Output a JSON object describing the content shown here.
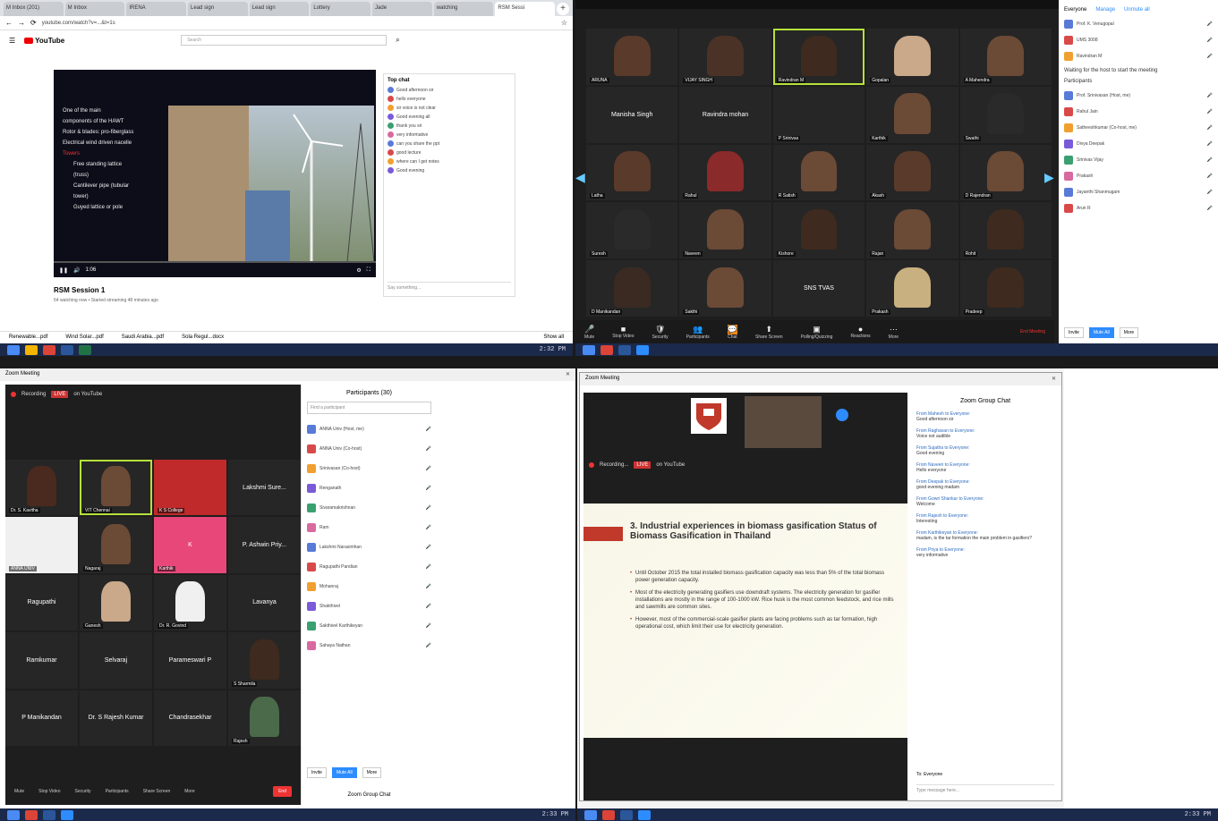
{
  "q1": {
    "tabs": [
      "M Inbox (201)",
      "M Inbox",
      "IRENA",
      "Lead sign",
      "Lead sign",
      "Lottery",
      "Jade",
      "watching",
      "RSM Sessi"
    ],
    "url": "youtube.com/watch?v=...&t=1s",
    "search_placeholder": "Search",
    "slide_title": "",
    "bullets": [
      "One of the main",
      "components of the HAWT",
      "Rotor & blades: pro-fiberglass",
      "Electrical wind driven nacelle",
      "Towers",
      "Free standing lattice",
      "(truss)",
      "Cantilever pipe (tubular",
      "tower)",
      "Guyed lattice or pole"
    ],
    "time": "1:06",
    "video_title": "RSM Session 1",
    "video_meta": "64 watching now • Started streaming 48 minutes ago",
    "chat_head": "Top chat",
    "chat": [
      "Good afternoon sir",
      "hello everyone",
      "sir voice is not clear",
      "Good evening all",
      "thank you sir",
      "very informative",
      "can you share the ppt",
      "good lecture",
      "where can I get notes",
      "Good evening"
    ],
    "chat_input": "Say something...",
    "downloads": [
      "Renewable...pdf",
      "Wind Solar...pdf",
      "Saudi Arabia...pdf",
      "Sola Regul...docx"
    ],
    "show_all": "Show all",
    "clock": "2:32 PM"
  },
  "q2": {
    "tiles": [
      {
        "name": "ARUNA",
        "face": "#5a3a2a"
      },
      {
        "name": "VIJAY SINGH",
        "face": "#4b3226"
      },
      {
        "name": "Ravindran M",
        "face": "#3e2a1e",
        "speaking": true
      },
      {
        "name": "Gopalan",
        "face": "#c9a98a"
      },
      {
        "name": "A Mahendra",
        "face": "#6b4a36"
      },
      {
        "name": "",
        "text": "Manisha Singh"
      },
      {
        "name": "",
        "text": "Ravindra mohan"
      },
      {
        "name": "P Srinivas",
        "face": ""
      },
      {
        "name": "Karthik",
        "face": "#6b4a36"
      },
      {
        "name": "Swathi",
        "face": "#2a2a2a"
      },
      {
        "name": "Latha",
        "face": "#5a3a2a"
      },
      {
        "name": "Rahul",
        "face": "#8a2a2a"
      },
      {
        "name": "R Satish",
        "face": "#6b4a36"
      },
      {
        "name": "Akash",
        "face": "#5a3a2a"
      },
      {
        "name": "D Rajendran",
        "face": "#6b4a36"
      },
      {
        "name": "Suresh",
        "face": "#2a2a2a"
      },
      {
        "name": "Naveen",
        "face": "#6b4a36"
      },
      {
        "name": "Kishore",
        "face": "#3e2a1e"
      },
      {
        "name": "Rajan",
        "face": "#6b4a36"
      },
      {
        "name": "Rohit",
        "face": "#3e2a1e"
      },
      {
        "name": "D Manikandan",
        "face": "#3a2a22"
      },
      {
        "name": "Sakthi",
        "face": "#6b4a36"
      },
      {
        "name": "",
        "text": "SNS TVAS"
      },
      {
        "name": "Prakash",
        "face": "#c9b080"
      },
      {
        "name": "Pradeep",
        "face": "#3e2a1e"
      }
    ],
    "bar": [
      {
        "g": "🎤",
        "l": "Mute"
      },
      {
        "g": "■",
        "l": "Stop Video"
      },
      {
        "g": "🛡",
        "l": "Security"
      },
      {
        "g": "👥",
        "l": "Participants"
      },
      {
        "g": "💬",
        "l": "Chat",
        "orange": true
      },
      {
        "g": "⬆",
        "l": "Share Screen"
      },
      {
        "g": "▣",
        "l": "Polling/Quizzing"
      },
      {
        "g": "●",
        "l": "Reactions"
      },
      {
        "g": "⋯",
        "l": "More"
      }
    ],
    "end": "End Meeting",
    "panel_tabs": [
      "Everyone",
      "Manage",
      "Unmute all"
    ],
    "panel_top": [
      "Prof. K. Venugopal",
      "UMS 3008",
      "Ravindran M"
    ],
    "waiting_head": "Waiting for the host to start the meeting",
    "section": "Participants",
    "participants": [
      "Prof. Srinivasan (Host, me)",
      "Rahul Jain",
      "Satheeshkumar (Co-host, me)",
      "Divya Deepak",
      "Srinivas Vijay",
      "Prakash",
      "Jayanthi Shanmugam",
      "Arun R"
    ],
    "panel_btns": [
      "Invite",
      "Mute All",
      "More"
    ]
  },
  "q3": {
    "title": "Zoom Meeting",
    "rec": "Recording",
    "live": "LIVE",
    "live_label": "on YouTube",
    "tiles": [
      {
        "name": "Dr. S. Kavitha",
        "face": "#4a2a1e"
      },
      {
        "name": "VIT Chennai",
        "face": "#6b4a36",
        "speaking": true
      },
      {
        "name": "K S College",
        "text": "",
        "color": "#c02a2a"
      },
      {
        "name": "",
        "text": "Lakshmi Sure..."
      },
      {
        "name": "ANNA UNIV",
        "text": "",
        "color": "#f0f0f0"
      },
      {
        "name": "Nagaraj",
        "face": "#6b4a36"
      },
      {
        "name": "Karthik",
        "text": "K",
        "color": "#e8477a"
      },
      {
        "name": "",
        "text": "P. Ashwin Priy..."
      },
      {
        "name": "",
        "text": "Ragupathi"
      },
      {
        "name": "Ganesh",
        "face": "#c9a98a"
      },
      {
        "name": "Dr. R. Govind",
        "face": "#f0f0f0"
      },
      {
        "name": "",
        "text": "Lavanya"
      },
      {
        "name": "",
        "text": "Ramkumar"
      },
      {
        "name": "",
        "text": "Selvaraj"
      },
      {
        "name": "",
        "text": "Parameswari P"
      },
      {
        "name": "S Sharmila",
        "face": "#3e2a1e"
      },
      {
        "name": "",
        "text": "P Manikandan"
      },
      {
        "name": "",
        "text": "Dr. S Rajesh Kumar"
      },
      {
        "name": "",
        "text": "Chandrasekhar"
      },
      {
        "name": "Rajesh",
        "face": "#4a6a4a"
      }
    ],
    "bar": [
      "Mute",
      "Stop Video",
      "Security",
      "Participants",
      "Share Screen",
      "More"
    ],
    "end": "End",
    "plist_head": "Participants (30)",
    "plist_search": "Find a participant",
    "participants": [
      "ANNA Univ (Host, me)",
      "ANNA Univ (Co-host)",
      "Srinivasan (Co-host)",
      "Renganath",
      "Sivaramakrishnan",
      "Ram",
      "Lakshmi Narasimhan",
      "Ragupathi Pandian",
      "Mohanraj",
      "Shakthivel",
      "Sakthivel Karthikeyan",
      "Sahaya Nathan"
    ],
    "plist_btns": [
      "Invite",
      "Mute All",
      "More"
    ],
    "footer": "Zoom Group Chat",
    "clock": "2:33 PM"
  },
  "q4": {
    "title": "Zoom Meeting",
    "rec": "Recording...",
    "live": "LIVE",
    "live_label": "on YouTube",
    "slide_title": "3. Industrial experiences in biomass gasification Status of Biomass Gasification in Thailand",
    "slide_bullets": [
      "Until October 2015 the total installed biomass gasification capacity was less than 5% of the total biomass power generation capacity.",
      "Most of the electricity generating gasifiers use downdraft systems. The electricity generation for gasifier installations are mostly in the range of 100-1000 kW. Rice husk is the most common feedstock, and rice mills and sawmills are common sites.",
      "However, most of the commercial-scale gasifier plants are facing problems such as tar formation, high operational cost, which limit their use for electricity generation."
    ],
    "chat_head": "Zoom Group Chat",
    "chat": [
      {
        "f": "From Mahesh to Everyone:",
        "t": "Good afternoon sir"
      },
      {
        "f": "From Raghavan to Everyone:",
        "t": "Voice not audible"
      },
      {
        "f": "From Sujatha to Everyone:",
        "t": "Good evening"
      },
      {
        "f": "From Naveen to Everyone:",
        "t": "Hello everyone"
      },
      {
        "f": "From Deepak to Everyone:",
        "t": "good evening madam"
      },
      {
        "f": "From Gowri Shankar to Everyone:",
        "t": "Welcome"
      },
      {
        "f": "From Rajesh to Everyone:",
        "t": "Interesting"
      },
      {
        "f": "From Karthikeyan to Everyone:",
        "t": "madam, is the tar formation the main problem in gasifiers?"
      },
      {
        "f": "From Priya to Everyone:",
        "t": "very informative"
      }
    ],
    "chat_to": "Everyone",
    "chat_placeholder": "Type message here...",
    "clock": "2:33 PM"
  }
}
